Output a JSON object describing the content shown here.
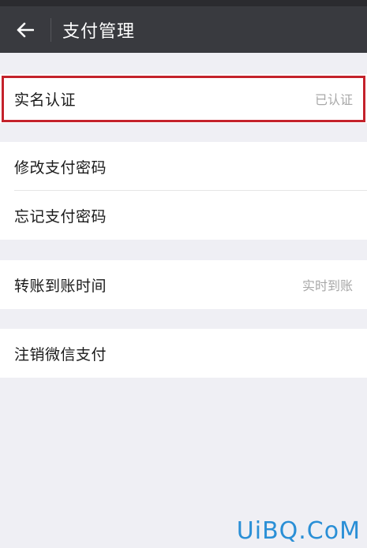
{
  "header": {
    "title": "支付管理",
    "back_icon": "arrow-left-icon"
  },
  "groups": [
    {
      "rows": [
        {
          "label": "实名认证",
          "value": "已认证"
        }
      ]
    },
    {
      "rows": [
        {
          "label": "修改支付密码",
          "value": ""
        },
        {
          "label": "忘记支付密码",
          "value": ""
        }
      ]
    },
    {
      "rows": [
        {
          "label": "转账到账时间",
          "value": "实时到账"
        }
      ]
    },
    {
      "rows": [
        {
          "label": "注销微信支付",
          "value": ""
        }
      ]
    }
  ],
  "annotation": {
    "highlight_color": "#c4222b"
  },
  "watermark": "UiBQ.CoM",
  "colors": {
    "header_bg": "#393a3f",
    "page_bg": "#efeff4",
    "value_text": "#a8a8a8"
  }
}
